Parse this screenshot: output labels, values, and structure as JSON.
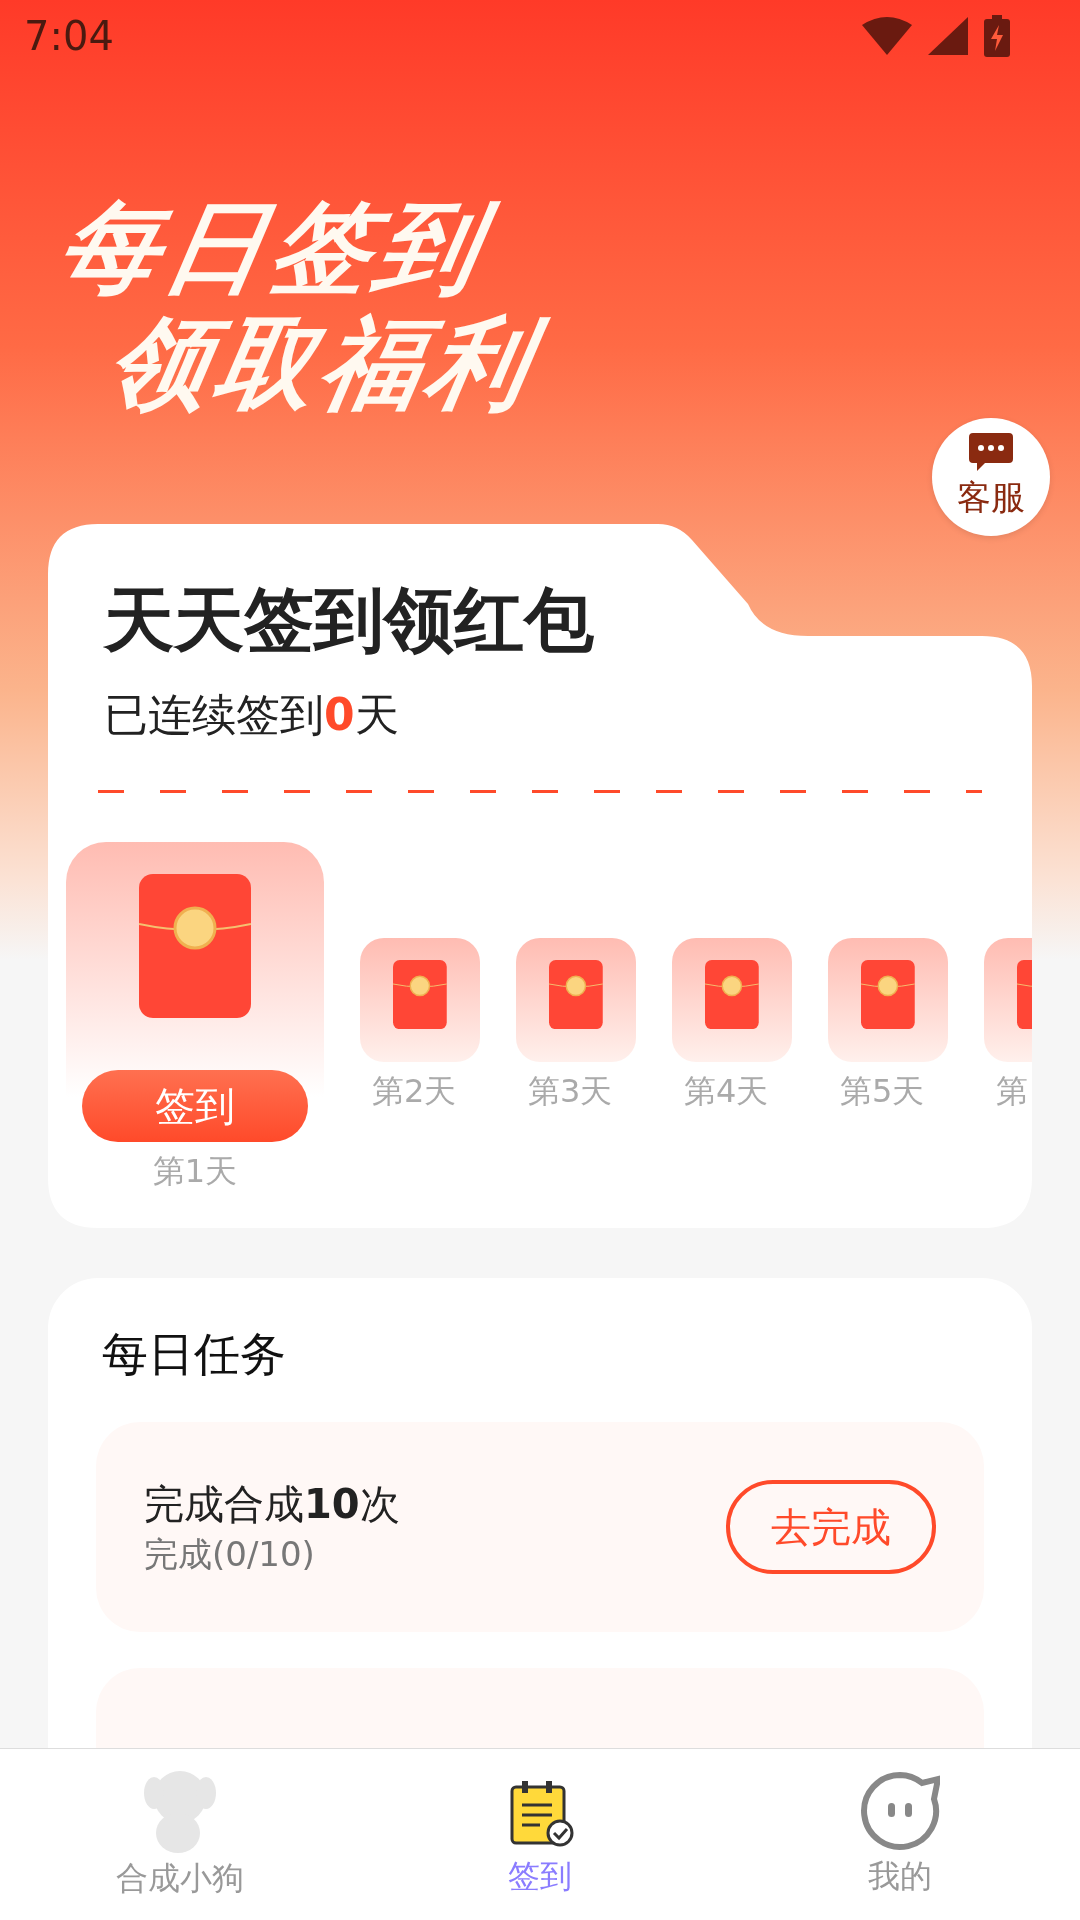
{
  "status_bar": {
    "time": "7:04"
  },
  "banner": {
    "title_line_1": "每日签到",
    "title_line_2": "领取福利"
  },
  "service_button": {
    "label": "客服"
  },
  "checkin_card": {
    "title": "天天签到领红包",
    "streak_prefix": "已连续签到",
    "streak_count": "0",
    "streak_suffix": "天"
  },
  "days": [
    {
      "label": "第1天",
      "selected": true,
      "button": "签到"
    },
    {
      "label": "第2天",
      "selected": false
    },
    {
      "label": "第3天",
      "selected": false
    },
    {
      "label": "第4天",
      "selected": false
    },
    {
      "label": "第5天",
      "selected": false
    },
    {
      "label": "第",
      "selected": false
    }
  ],
  "tasks_card": {
    "title": "每日任务"
  },
  "tasks": [
    {
      "kind": "full",
      "title": "完成合成**10**次",
      "progress": "完成(0/10)",
      "button": "去完成"
    },
    {
      "kind": "cut"
    }
  ],
  "bottom_nav": [
    {
      "label": "合成小狗",
      "kind": "dog",
      "selected": false
    },
    {
      "label": "签到",
      "kind": "calendar",
      "selected": true
    },
    {
      "label": "我的",
      "kind": "face",
      "selected": false
    }
  ]
}
